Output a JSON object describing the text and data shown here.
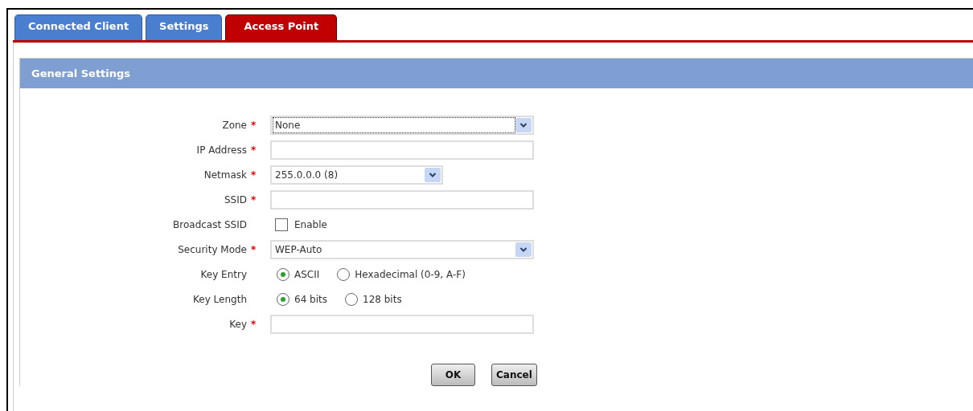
{
  "tabs": [
    {
      "label": "Connected Client",
      "selected": false
    },
    {
      "label": "Settings",
      "selected": false
    },
    {
      "label": "Access Point",
      "selected": true
    }
  ],
  "panel": {
    "title": "General Settings",
    "rows": [
      {
        "label": "Zone",
        "asterisk": "*",
        "kind": "select",
        "value": "None",
        "focused": true
      },
      {
        "label": "IP Address",
        "asterisk": "*",
        "kind": "text"
      },
      {
        "label": "Netmask",
        "asterisk": "*",
        "kind": "shortselect",
        "value": "255.0.0.0 (8)",
        "focused": false
      },
      {
        "label": "SSID",
        "asterisk": "*",
        "kind": "text"
      },
      {
        "label": "Broadcast SSID",
        "kind": "checkbox",
        "options": [
          {
            "label": "Enable",
            "checked": false
          }
        ]
      },
      {
        "label": "Security Mode",
        "asterisk": "*",
        "kind": "select",
        "value": "WEP-Auto",
        "focused": false
      },
      {
        "label": "Key Entry",
        "kind": "radio",
        "options": [
          {
            "label": "ASCII",
            "selected": true
          },
          {
            "label": "Hexadecimal (0-9, A-F)",
            "selected": false
          }
        ]
      },
      {
        "label": "Key Length",
        "kind": "radio",
        "options": [
          {
            "label": "64 bits",
            "selected": true
          },
          {
            "label": "128 bits",
            "selected": false
          }
        ]
      },
      {
        "label": "Key",
        "asterisk": "*",
        "kind": "text"
      }
    ],
    "buttons": [
      "OK",
      "Cancel"
    ]
  }
}
